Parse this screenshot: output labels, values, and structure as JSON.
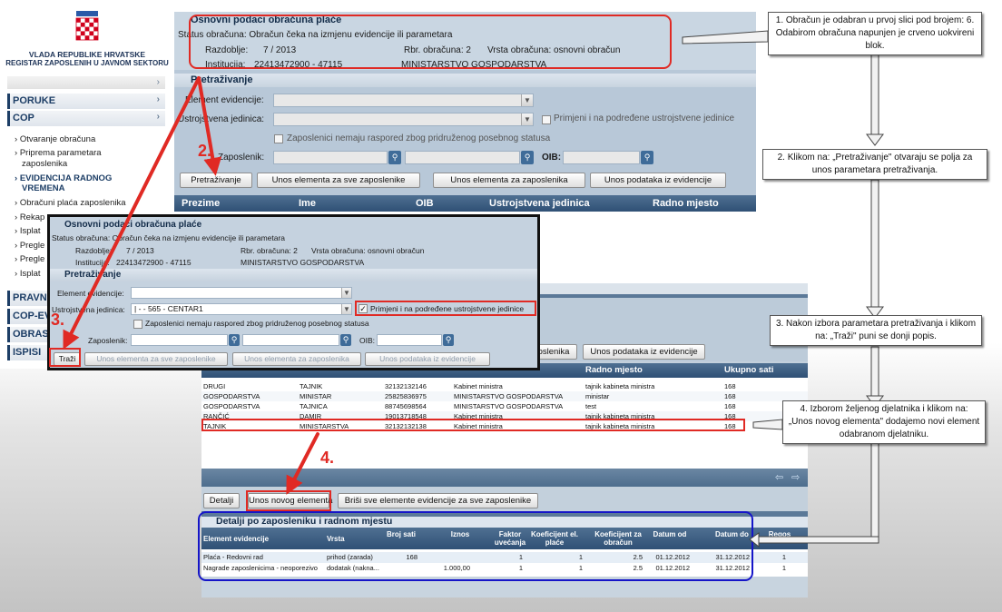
{
  "org": {
    "line1": "VLADA REPUBLIKE HRVATSKE",
    "line2": "REGISTAR ZAPOSLENIH U JAVNOM SEKTORU"
  },
  "sidebar": {
    "poruke": "PORUKE",
    "cop": "COP",
    "items": [
      "Otvaranje obračuna",
      "Priprema parametara",
      "zaposlenika",
      "EVIDENCIJA RADNOG",
      "VREMENA",
      "Obračuni plaća zaposlenika",
      "Rekap",
      "Isplat",
      "Pregle",
      "Pregle",
      "Isplat"
    ],
    "bottom": [
      "PRAVNI",
      "COP-EV",
      "OBRASC",
      "ISPISI"
    ]
  },
  "main": {
    "title": "Osnovni podaci obračuna plaće",
    "status": "Status obračuna: Obračun čeka na izmjenu evidencije ili parametara",
    "razdoblje_label": "Razdoblje:",
    "razdoblje_value": "7 / 2013",
    "rbr": "Rbr. obračuna: 2",
    "vrsta": "Vrsta obračuna: osnovni obračun",
    "institucija_label": "Institucija:",
    "institucija_value": "22413472900 - 47115",
    "ministarstvo": "MINISTARSTVO GOSPODARSTVA",
    "search_title": "Pretraživanje",
    "element_label": "Element evidencije:",
    "ustroj_label": "Ustrojstvena jedinica:",
    "primjeni": "Primjeni i na podređene ustrojstvene jedinice",
    "zaposlenici_nemaju": "Zaposlenici nemaju raspored zbog pridruženog posebnog statusa",
    "zaposlenik_label": "Zaposlenik:",
    "oib_label": "OIB:",
    "buttons": [
      "Pretraživanje",
      "Unos elementa za sve zaposlenike",
      "Unos elementa za zaposlenika",
      "Unos podataka iz evidencije"
    ],
    "columns": [
      "Prezime",
      "Ime",
      "OIB",
      "Ustrojstvena jedinica",
      "Radno mjesto"
    ]
  },
  "popup": {
    "title": "Osnovni podaci obračuna plaće",
    "status": "Status obračuna: Obračun čeka na izmjenu evidencije ili parametara",
    "razdoblje": "Razdoblje:",
    "razdoblje_value": "7 / 2013",
    "rbr": "Rbr. obračuna: 2",
    "vrsta": "Vrsta obračuna: osnovni obračun",
    "institucija": "Institucija:",
    "institucija_value": "22413472900 - 47115",
    "ministarstvo": "MINISTARSTVO GOSPODARSTVA",
    "search_title": "Pretraživanje",
    "element_label": "Element evidencije:",
    "ustroj_label": "Ustrojstvena jedinica:",
    "ustroj_value": "| - - 565 - CENTAR1",
    "primjeni": "Primjeni i na podređene ustrojstvene jedinice",
    "zaposlenici_nemaju": "Zaposlenici nemaju raspored zbog pridruženog posebnog statusa",
    "zaposlenik_label": "Zaposlenik:",
    "oib_label": "OIB:",
    "buttons": [
      "Traži",
      "Unos elementa za sve zaposlenike",
      "Unos elementa za zaposlenika",
      "Unos podataka iz evidencije"
    ]
  },
  "results": {
    "btn_partial": "oslenika",
    "btn_unos": "Unos podataka iz evidencije",
    "col_radno": "Radno mjesto",
    "col_sati": "Ukupno sati",
    "rows": [
      [
        "DRUGI",
        "TAJNIK",
        "32132132146",
        "Kabinet ministra",
        "tajnik kabineta ministra",
        "168"
      ],
      [
        "GOSPODARSTVA",
        "MINISTAR",
        "25825836975",
        "MINISTARSTVO GOSPODARSTVA",
        "ministar",
        "168"
      ],
      [
        "GOSPODARSTVA",
        "TAJNICA",
        "88745698564",
        "MINISTARSTVO GOSPODARSTVA",
        "test",
        "168"
      ],
      [
        "RANČIĆ",
        "DAMIR",
        "19013718548",
        "Kabinet ministra",
        "tajnik kabineta ministra",
        "168"
      ],
      [
        "TAJNIK",
        "MINISTARSTVA",
        "32132132138",
        "Kabinet ministra",
        "tajnik kabineta ministra",
        "168"
      ]
    ],
    "actions": [
      "Detalji",
      "Unos novog elementa",
      "Briši sve elemente evidencije za sve zaposlenike"
    ]
  },
  "details": {
    "title": "Detalji po zaposleniku i radnom mjestu",
    "columns": [
      "Element evidencije",
      "Vrsta",
      "Broj sati",
      "Iznos",
      "Faktor uvećanja",
      "Koeficijent el. plaće",
      "Koeficijent za obračun",
      "Datum od",
      "Datum do",
      "Regos"
    ],
    "rows": [
      [
        "Plaća - Redovni rad",
        "prihod (zarada)",
        "168",
        "",
        "1",
        "1",
        "2.5",
        "01.12.2012",
        "31.12.2012",
        "1"
      ],
      [
        "Nagrade zaposlenicima - neoporezivo",
        "dodatak (nakna...",
        "",
        "1.000,00",
        "1",
        "1",
        "2.5",
        "01.12.2012",
        "31.12.2012",
        "1"
      ]
    ]
  },
  "annotations": {
    "n1": "1. Obračun je odabran u prvoj slici pod brojem: 6. Odabirom obračuna napunjen je crveno uokvireni blok.",
    "n2": "2. Klikom na: „Pretraživanje\" otvaraju se polja za unos parametara pretraživanja.",
    "n3": "3. Nakon izbora parametara pretraživanja i klikom na: „Traži\" puni se donji popis.",
    "n4": "4. Izborom željenog djelatnika i klikom na: „Unos novog elementa\" dodajemo novi element odabranom djelatniku.",
    "steps": [
      "2.",
      "3.",
      "4."
    ]
  },
  "colors": {
    "accent_red": "#e02a24",
    "header_blue": "#2f5075",
    "highlight_blue": "#1515c8"
  }
}
